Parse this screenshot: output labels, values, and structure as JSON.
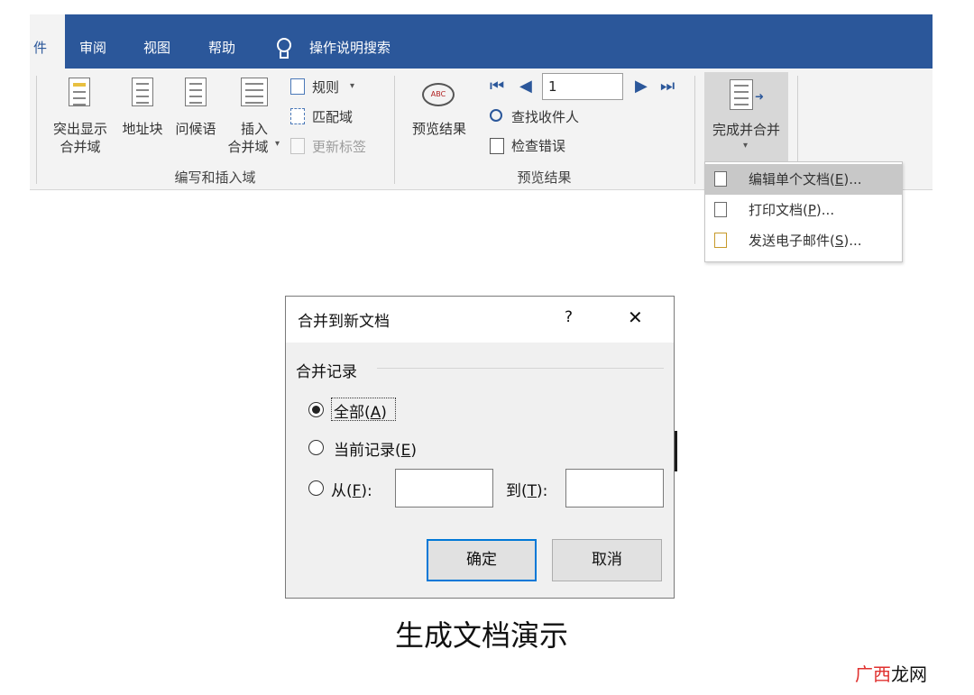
{
  "ribbon": {
    "tabs": [
      "件",
      "审阅",
      "视图",
      "帮助",
      "操作说明搜索"
    ],
    "group_write_insert": {
      "label": "编写和插入域",
      "highlight_merge_fields": [
        "突出显示",
        "合并域"
      ],
      "address_block": "地址块",
      "greeting_line": "问候语",
      "insert_merge_field": [
        "插入",
        "合并域"
      ],
      "rules": "规则",
      "match_fields": "匹配域",
      "update_labels": "更新标签"
    },
    "group_preview": {
      "label": "预览结果",
      "preview_results": "预览结果",
      "record_value": "1",
      "find_recipient": "查找收件人",
      "check_errors": "检查错误"
    },
    "finish_merge": "完成并合并"
  },
  "dropdown_menu": {
    "items": [
      {
        "label": "编辑单个文档",
        "key": "E",
        "suffix": "..."
      },
      {
        "label": "打印文档",
        "key": "P",
        "suffix": "..."
      },
      {
        "label": "发送电子邮件",
        "key": "S",
        "suffix": "..."
      }
    ]
  },
  "dialog": {
    "title": "合并到新文档",
    "help": "?",
    "close": "✕",
    "group_label": "合并记录",
    "options": [
      {
        "label": "全部",
        "key": "A",
        "selected": true
      },
      {
        "label": "当前记录",
        "key": "E",
        "selected": false
      },
      {
        "label": "从",
        "key": "F",
        "selected": false
      }
    ],
    "from_value": "",
    "to_label": "到",
    "to_key": "T",
    "to_value": "",
    "ok": "确定",
    "cancel": "取消"
  },
  "caption": "生成文档演示",
  "watermark": {
    "text": "广西龙网",
    "color_1": "#e0312f",
    "color_2": "#111111"
  },
  "colors": {
    "accent": "#2b579a",
    "dialog_focus": "#0078d7"
  }
}
